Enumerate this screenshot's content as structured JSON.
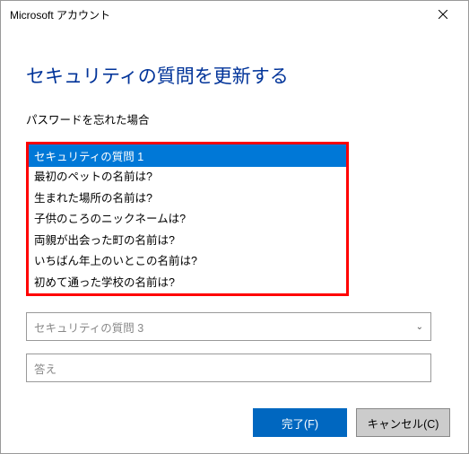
{
  "titlebar": {
    "title": "Microsoft アカウント"
  },
  "heading": "セキュリティの質問を更新する",
  "subtitle": "パスワードを忘れた場合",
  "dropdown": {
    "selected": "セキュリティの質問 1",
    "options": [
      "最初のペットの名前は?",
      "生まれた場所の名前は?",
      "子供のころのニックネームは?",
      "両親が出会った町の名前は?",
      "いちばん年上のいとこの名前は?",
      "初めて通った学校の名前は?"
    ]
  },
  "question3": {
    "placeholder": "セキュリティの質問 3"
  },
  "answer": {
    "placeholder": "答え"
  },
  "buttons": {
    "finish": "完了(F)",
    "cancel": "キャンセル(C)"
  }
}
